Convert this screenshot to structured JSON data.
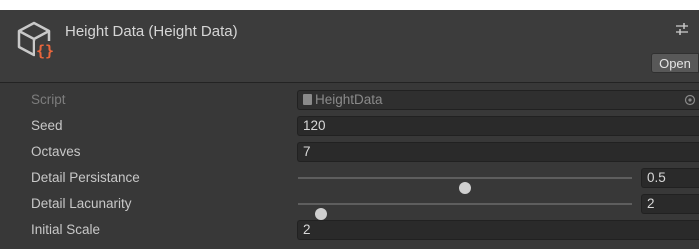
{
  "header": {
    "title": "Height Data (Height Data)",
    "open_label": "Open",
    "asset_icon": "scriptable-object-icon",
    "settings_icon": "settings-sliders-icon"
  },
  "fields": {
    "script": {
      "label": "Script",
      "value": "HeightData",
      "icon": "script-icon"
    },
    "seed": {
      "label": "Seed",
      "value": "120"
    },
    "octaves": {
      "label": "Octaves",
      "value": "7"
    },
    "detail_persistance": {
      "label": "Detail Persistance",
      "value": "0.5",
      "slider_fraction": 0.5
    },
    "detail_lacunarity": {
      "label": "Detail Lacunarity",
      "value": "2",
      "slider_fraction": 0.07
    },
    "initial_scale": {
      "label": "Initial Scale",
      "value": "2"
    }
  },
  "colors": {
    "panel": "#383838",
    "header": "#3c3c3c",
    "field": "#2a2a2a",
    "icon_accent": "#e9663c",
    "icon_outline": "#c9c9c9"
  }
}
